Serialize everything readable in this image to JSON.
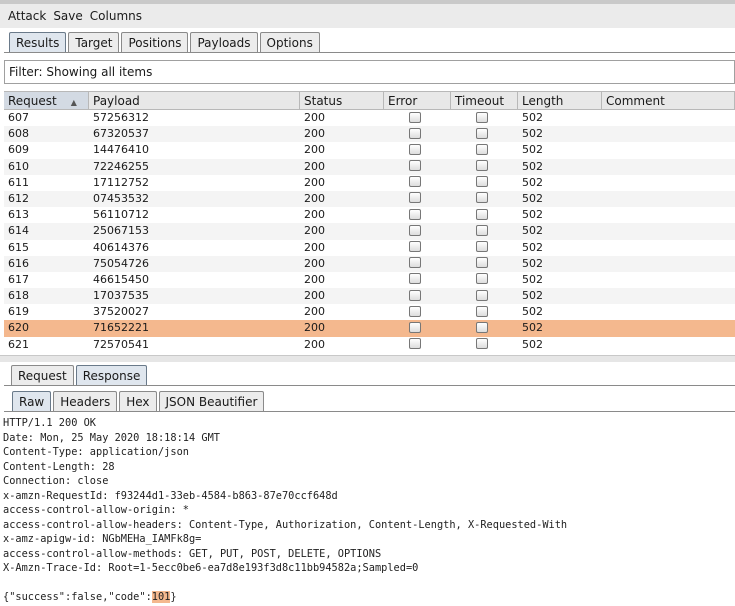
{
  "menu": [
    "Attack",
    "Save",
    "Columns"
  ],
  "main_tabs": [
    {
      "label": "Results",
      "active": true
    },
    {
      "label": "Target",
      "active": false
    },
    {
      "label": "Positions",
      "active": false
    },
    {
      "label": "Payloads",
      "active": false
    },
    {
      "label": "Options",
      "active": false
    }
  ],
  "filter_text": "Filter: Showing all items",
  "table": {
    "columns": [
      "Request",
      "Payload",
      "Status",
      "Error",
      "Timeout",
      "Length",
      "Comment"
    ],
    "sorted_column": "Request",
    "rows": [
      {
        "request": "607",
        "payload": "57256312",
        "status": "200",
        "length": "502"
      },
      {
        "request": "608",
        "payload": "67320537",
        "status": "200",
        "length": "502"
      },
      {
        "request": "609",
        "payload": "14476410",
        "status": "200",
        "length": "502"
      },
      {
        "request": "610",
        "payload": "72246255",
        "status": "200",
        "length": "502"
      },
      {
        "request": "611",
        "payload": "17112752",
        "status": "200",
        "length": "502"
      },
      {
        "request": "612",
        "payload": "07453532",
        "status": "200",
        "length": "502"
      },
      {
        "request": "613",
        "payload": "56110712",
        "status": "200",
        "length": "502"
      },
      {
        "request": "614",
        "payload": "25067153",
        "status": "200",
        "length": "502"
      },
      {
        "request": "615",
        "payload": "40614376",
        "status": "200",
        "length": "502"
      },
      {
        "request": "616",
        "payload": "75054726",
        "status": "200",
        "length": "502"
      },
      {
        "request": "617",
        "payload": "46615450",
        "status": "200",
        "length": "502"
      },
      {
        "request": "618",
        "payload": "17037535",
        "status": "200",
        "length": "502"
      },
      {
        "request": "619",
        "payload": "37520027",
        "status": "200",
        "length": "502"
      },
      {
        "request": "620",
        "payload": "71652221",
        "status": "200",
        "length": "502",
        "selected": true
      },
      {
        "request": "621",
        "payload": "72570541",
        "status": "200",
        "length": "502"
      }
    ]
  },
  "req_resp_tabs": [
    {
      "label": "Request",
      "active": false
    },
    {
      "label": "Response",
      "active": true
    }
  ],
  "view_tabs": [
    {
      "label": "Raw",
      "active": true
    },
    {
      "label": "Headers",
      "active": false
    },
    {
      "label": "Hex",
      "active": false
    },
    {
      "label": "JSON Beautifier",
      "active": false
    }
  ],
  "response": {
    "lines": [
      "HTTP/1.1 200 OK",
      "Date: Mon, 25 May 2020 18:18:14 GMT",
      "Content-Type: application/json",
      "Content-Length: 28",
      "Connection: close",
      "x-amzn-RequestId: f93244d1-33eb-4584-b863-87e70ccf648d",
      "access-control-allow-origin: *",
      "access-control-allow-headers: Content-Type, Authorization, Content-Length, X-Requested-With",
      "x-amz-apigw-id: NGbMEHa_IAMFk8g=",
      "access-control-allow-methods: GET, PUT, POST, DELETE, OPTIONS",
      "X-Amzn-Trace-Id: Root=1-5ecc0be6-ea7d8e193f3d8c11bb94582a;Sampled=0",
      ""
    ],
    "body_prefix": "{\"success\":false,\"code\":",
    "body_highlight": "101",
    "body_suffix": "}"
  },
  "colors": {
    "selected_row": "#f4b88e",
    "highlight": "#f4b88e"
  }
}
